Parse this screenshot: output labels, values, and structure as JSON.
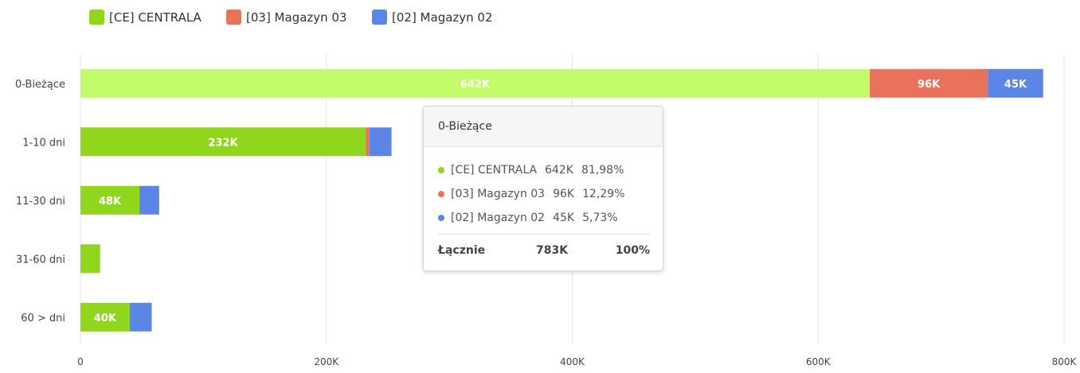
{
  "chart_data": {
    "type": "bar",
    "orientation": "horizontal",
    "stacked": true,
    "categories": [
      "0-Bieżące",
      "1-10 dni",
      "11-30 dni",
      "31-60 dni",
      "60 > dni"
    ],
    "series": [
      {
        "name": "[CE] CENTRALA",
        "color": "#8fd61c",
        "values": [
          642000,
          232000,
          48000,
          16000,
          40000
        ],
        "labels": [
          "642K",
          "232K",
          "48K",
          "",
          "40K"
        ]
      },
      {
        "name": "[03] Magazyn 03",
        "color": "#e8725a",
        "values": [
          96000,
          3000,
          0,
          0,
          0
        ],
        "labels": [
          "96K",
          "",
          "",
          "",
          ""
        ]
      },
      {
        "name": "[02] Magazyn 02",
        "color": "#5b86e5",
        "values": [
          45000,
          18000,
          16000,
          0,
          18000
        ],
        "labels": [
          "45K",
          "",
          "",
          "",
          ""
        ]
      }
    ],
    "xlim": [
      0,
      800000
    ],
    "xticks": [
      {
        "value": 0,
        "label": "0"
      },
      {
        "value": 200000,
        "label": "200K"
      },
      {
        "value": 400000,
        "label": "400K"
      },
      {
        "value": 600000,
        "label": "600K"
      },
      {
        "value": 800000,
        "label": "800K"
      }
    ],
    "grid": true,
    "legend_position": "top-left",
    "highlighted_category": "0-Bieżące",
    "highlight_colors": [
      "#c2fc6b",
      "#e8725a",
      "#5b86e5"
    ]
  },
  "tooltip": {
    "title": "0-Bieżące",
    "rows": [
      {
        "name": "[CE] CENTRALA",
        "value": "642K",
        "percent": "81,98%",
        "color": "#8fd61c"
      },
      {
        "name": "[03] Magazyn 03",
        "value": "96K",
        "percent": "12,29%",
        "color": "#e8725a"
      },
      {
        "name": "[02] Magazyn 02",
        "value": "45K",
        "percent": "5,73%",
        "color": "#5b86e5"
      }
    ],
    "total_label": "Łącznie",
    "total_value": "783K",
    "total_percent": "100%"
  }
}
